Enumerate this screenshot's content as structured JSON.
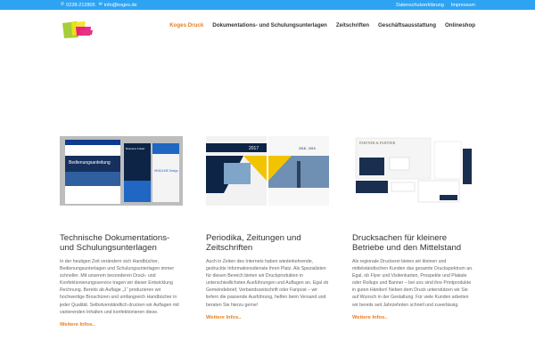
{
  "topbar": {
    "phone": "0228-212805",
    "email": "info@koges.de",
    "phone_icon": "phone-icon",
    "mail_icon": "mail-icon",
    "links": [
      "Datenschutzerklärung",
      "Impressum"
    ]
  },
  "nav": {
    "items": [
      "Koges Druck",
      "Dokumentations- und Schulungsunterlagen",
      "Zeitschriften",
      "Geschäftsausstattung",
      "Onlineshop"
    ],
    "active_index": 0
  },
  "colors": {
    "topbar": "#2ea3f2",
    "accent": "#e67e22",
    "heading": "#333333",
    "text": "#666666"
  },
  "cards": [
    {
      "image_texts": [
        "Bedienungsanleitung",
        "Business Folder",
        "HEADLINE Design"
      ],
      "title": "Technische Dokumentations- und Schulungsunterlagen",
      "body": "In der heutigen Zeit verändern sich Handbücher, Bedienungsunterlagen und Schulungsunterlagen immer schneller. Mit unserem besonderen Druck- und Konfektionierungsservice tragen wir dieser Entwicklung Rechnung. Bereits ab Auflage „1“ produzieren wir hochwertige Broschüren und umfangreich Handbücher in jeder Qualität. Selbstverständlich drucken wir Auflagen mit variierenden Inhalten und konfektionieren diese.",
      "link": "Weitere Infos.."
    },
    {
      "image_texts": [
        "2017",
        "2018 - 2019"
      ],
      "title": "Periodika, Zeitungen und Zeitschriften",
      "body": "Auch in Zeiten des Internets haben wiederkehrende, gedruckte Informationsdienste ihren Platz. Als Spezialisten für diesen Bereich bieten wir Druckprodukten in unterschiedlichsten Ausführungen und Auflagen an. Egal ob Gemeindebrief, Verbandszeitschrift oder Fanpost – wir liefern die passende Ausführung, helfen beim Versand und beraten Sie hierzu gerne!",
      "link": "Weitere Infos.."
    },
    {
      "image_texts": [
        "PARTNER & PARTNER"
      ],
      "title": "Drucksachen für kleinere Betriebe und den Mittelstand",
      "body": "Als regionale Druckerei bieten wir kleinen und mittelständischen Kunden das gesamte Druckspektrum an. Egal, ob Flyer und Visitenkarten, Prospekte und Plakate oder Rollups und Banner – bei uns sind ihre Printprodukte in guten Händen! Neben dem Druck unterstützen wir Sie auf Wunsch in der Gestaltung. Für viele Kunden arbeiten wir bereits seit Jahrzehnten schnell und zuverlässig.",
      "link": "Weitere Infos.."
    }
  ]
}
